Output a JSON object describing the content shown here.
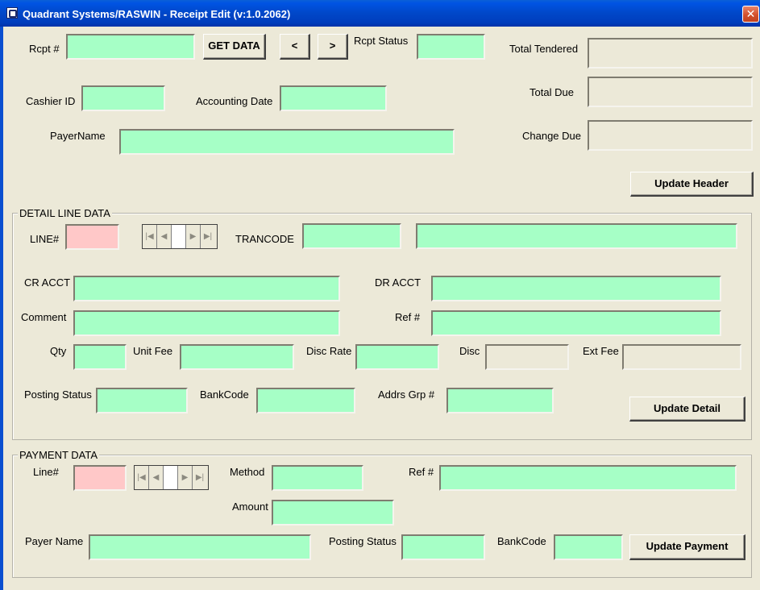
{
  "window": {
    "title": "Quadrant Systems/RASWIN - Receipt Edit (v:1.0.2062)",
    "close_glyph": "✕"
  },
  "header": {
    "rcpt_label": "Rcpt #",
    "rcpt_value": "",
    "get_data_label": "GET DATA",
    "prev_label": "<",
    "next_label": ">",
    "rcpt_status_label": "Rcpt Status",
    "rcpt_status_value": "",
    "cashier_label": "Cashier ID",
    "cashier_value": "",
    "accounting_date_label": "Accounting Date",
    "accounting_date_value": "",
    "payer_name_label": "PayerName",
    "payer_name_value": "",
    "total_tendered_label": "Total Tendered",
    "total_tendered_value": "",
    "total_due_label": "Total Due",
    "total_due_value": "",
    "change_due_label": "Change Due",
    "change_due_value": "",
    "update_header_label": "Update Header"
  },
  "detail": {
    "group_title": "DETAIL LINE DATA",
    "line_label": "LINE#",
    "line_value": "",
    "trancode_label": "TRANCODE",
    "trancode_value": "",
    "trancode_desc_value": "",
    "cr_acct_label": "CR ACCT",
    "cr_acct_value": "",
    "dr_acct_label": "DR ACCT",
    "dr_acct_value": "",
    "comment_label": "Comment",
    "comment_value": "",
    "ref_label": "Ref #",
    "ref_value": "",
    "qty_label": "Qty",
    "qty_value": "",
    "unit_fee_label": "Unit Fee",
    "unit_fee_value": "",
    "disc_rate_label": "Disc Rate",
    "disc_rate_value": "",
    "disc_label": "Disc",
    "disc_value": "",
    "ext_fee_label": "Ext Fee",
    "ext_fee_value": "",
    "posting_status_label": "Posting Status",
    "posting_status_value": "",
    "bank_code_label": "BankCode",
    "bank_code_value": "",
    "addrs_grp_label": "Addrs Grp #",
    "addrs_grp_value": "",
    "update_detail_label": "Update Detail"
  },
  "payment": {
    "group_title": "PAYMENT DATA",
    "line_label": "Line#",
    "line_value": "",
    "method_label": "Method",
    "method_value": "",
    "ref_label": "Ref #",
    "ref_value": "",
    "amount_label": "Amount",
    "amount_value": "",
    "payer_name_label": "Payer Name",
    "payer_name_value": "",
    "posting_status_label": "Posting Status",
    "posting_status_value": "",
    "bank_code_label": "BankCode",
    "bank_code_value": "",
    "update_payment_label": "Update Payment"
  },
  "navigator": {
    "first_icon": "first-record-icon",
    "prev_icon": "previous-record-icon",
    "next_icon": "next-record-icon",
    "last_icon": "last-record-icon",
    "first_glyph": "|◀",
    "prev_glyph": "◀",
    "next_glyph": "▶",
    "last_glyph": "▶|"
  },
  "colors": {
    "field": "#a6ffc6",
    "key_field": "#ffc8c8",
    "readonly_field": "#ece9d8",
    "window": "#ece9d8",
    "titlebar": "#0054e3"
  }
}
